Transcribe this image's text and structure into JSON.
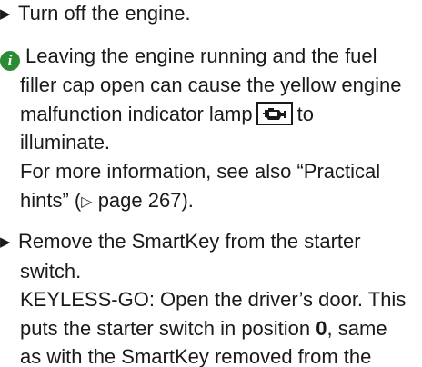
{
  "steps": {
    "turn_off": "Turn off the engine.",
    "remove_key_1": "Remove the SmartKey from the starter",
    "remove_key_2": "switch.",
    "keyless_1": "KEYLESS-GO: Open the driver’s door. This",
    "keyless_2": "puts the starter switch in position",
    "keyless_position": "0",
    "keyless_2_end": ", same",
    "keyless_3": "as with the SmartKey removed from the"
  },
  "info_note": {
    "icon": "info-icon",
    "line1": "Leaving the engine running and the fuel",
    "line2": "filler cap open can cause the yellow engine",
    "line3": "malfunction indicator lamp",
    "line3_end": "to",
    "line4": "illuminate.",
    "ref_line1": "For more information, see also “Practical",
    "ref_line2_start": "hints” (",
    "ref_symbol": "▷",
    "ref_page": "page 267",
    "ref_line2_end": ")."
  },
  "icons": {
    "bullet": "▶",
    "lamp_icon": "engine-malfunction-icon"
  },
  "colors": {
    "info_green": "#2b8a34",
    "text": "#1a1a1a"
  }
}
